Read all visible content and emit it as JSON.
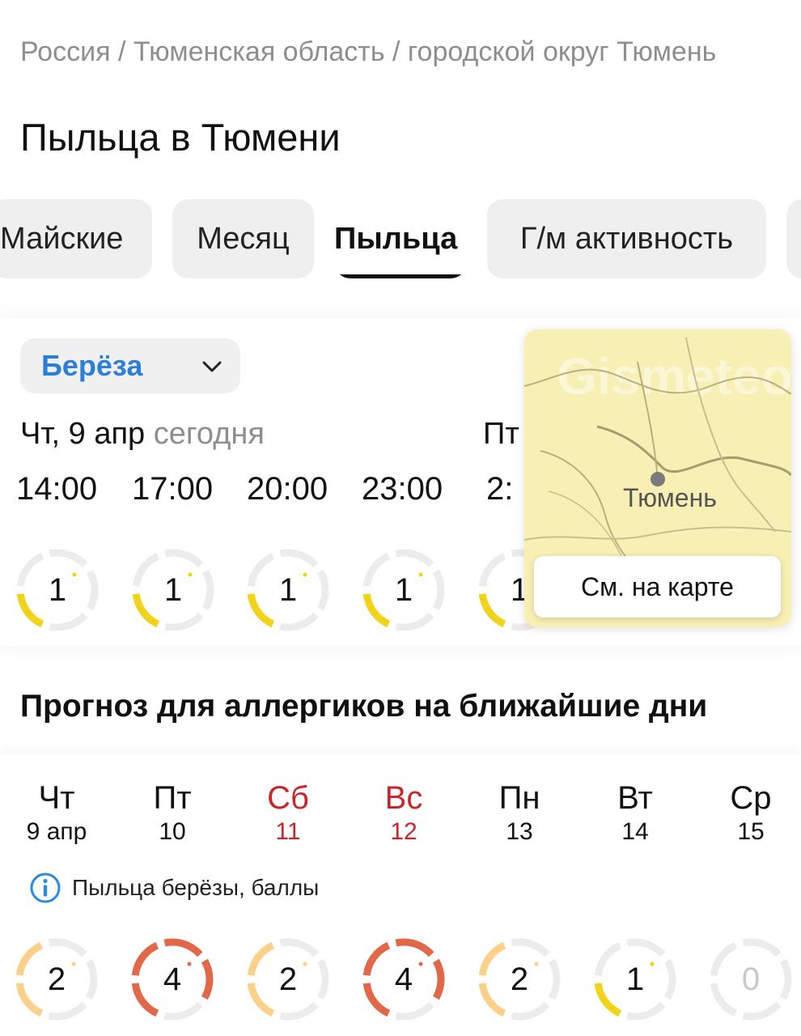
{
  "breadcrumb": "Россия / Тюменская область / городской округ Тюмень",
  "page_title": "Пыльца в Тюмени",
  "tabs": [
    {
      "label": "Майские",
      "active": false
    },
    {
      "label": "Месяц",
      "active": false
    },
    {
      "label": "Пыльца",
      "active": true
    },
    {
      "label": "Г/м активность",
      "active": false
    }
  ],
  "pollen_select": {
    "value": "Берёза"
  },
  "today": {
    "day": "Чт, 9 апр",
    "suffix": "сегодня",
    "next_day": "Пт",
    "hours": [
      {
        "time": "14:00",
        "value": 1
      },
      {
        "time": "17:00",
        "value": 1
      },
      {
        "time": "20:00",
        "value": 1
      },
      {
        "time": "23:00",
        "value": 1
      },
      {
        "time": "2:",
        "value": 1
      }
    ]
  },
  "map": {
    "city": "Тюмень",
    "button": "См. на карте",
    "watermark": "Gismeteo"
  },
  "forecast": {
    "title": "Прогноз для аллергиков на ближайшие дни",
    "legend": "Пыльца берёзы, баллы",
    "days": [
      {
        "name": "Чт",
        "date": "9 апр",
        "value": 2,
        "weekend": false
      },
      {
        "name": "Пт",
        "date": "10",
        "value": 4,
        "weekend": false
      },
      {
        "name": "Сб",
        "date": "11",
        "value": 2,
        "weekend": true
      },
      {
        "name": "Вс",
        "date": "12",
        "value": 4,
        "weekend": true
      },
      {
        "name": "Пн",
        "date": "13",
        "value": 2,
        "weekend": false
      },
      {
        "name": "Вт",
        "date": "14",
        "value": 1,
        "weekend": false
      },
      {
        "name": "Ср",
        "date": "15",
        "value": 0,
        "weekend": false
      }
    ]
  },
  "colors": {
    "level_1": "#f2d31b",
    "level_2": "#fbd08a",
    "level_4": "#e2684a",
    "gauge_track": "#ececec",
    "accent_blue": "#2b7fd8",
    "weekend_red": "#c8262a"
  }
}
